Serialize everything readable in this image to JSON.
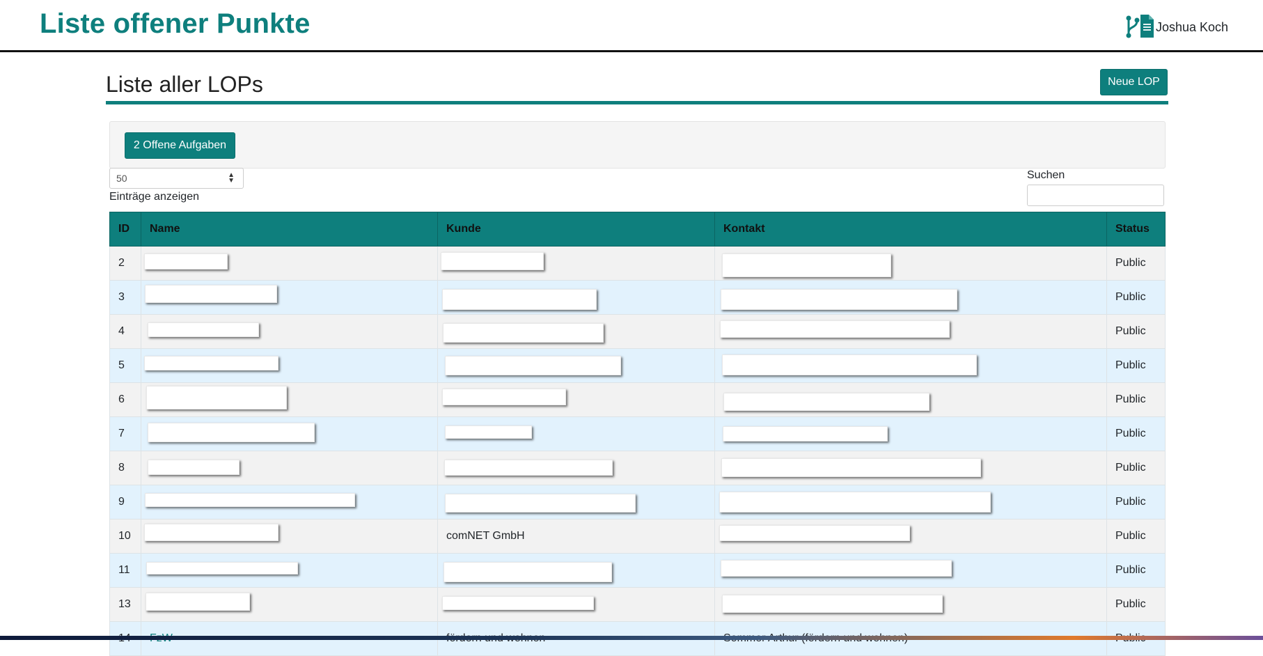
{
  "header": {
    "app_title": "Liste offener Punkte",
    "user_name": "Joshua Koch",
    "user_icon": "git-branch-document-icon"
  },
  "section": {
    "title": "Liste aller LOPs",
    "new_button": "Neue LOP"
  },
  "panel": {
    "open_tasks_button": "2 Offene Aufgaben"
  },
  "table_controls": {
    "page_length_value": "50",
    "page_length_label": "Einträge anzeigen",
    "search_label": "Suchen",
    "search_value": ""
  },
  "table": {
    "columns": [
      "ID",
      "Name",
      "Kunde",
      "Kontakt",
      "Status"
    ],
    "rows": [
      {
        "id": "2",
        "name": "",
        "kunde": "",
        "kontakt": "",
        "status": "Public"
      },
      {
        "id": "3",
        "name": "",
        "kunde": "",
        "kontakt": "",
        "status": "Public"
      },
      {
        "id": "4",
        "name": "",
        "kunde": "",
        "kontakt": "",
        "status": "Public"
      },
      {
        "id": "5",
        "name": "",
        "kunde": "",
        "kontakt": "",
        "status": "Public"
      },
      {
        "id": "6",
        "name": "",
        "kunde": "",
        "kontakt": "",
        "status": "Public"
      },
      {
        "id": "7",
        "name": "",
        "kunde": "",
        "kontakt": "",
        "status": "Public"
      },
      {
        "id": "8",
        "name": "",
        "kunde": "",
        "kontakt": "",
        "status": "Public"
      },
      {
        "id": "9",
        "name": "",
        "kunde": "",
        "kontakt": "",
        "status": "Public"
      },
      {
        "id": "10",
        "name": "",
        "kunde": "comNET GmbH",
        "kontakt": "",
        "status": "Public"
      },
      {
        "id": "11",
        "name": "",
        "kunde": "",
        "kontakt": "",
        "status": "Public"
      },
      {
        "id": "13",
        "name": "",
        "kunde": "",
        "kontakt": "",
        "status": "Public"
      },
      {
        "id": "14",
        "name": "FzW",
        "kunde": "fördern und wohnen",
        "kontakt": "Sommer Arthur (fördern und wohnen)",
        "status": "Public"
      }
    ]
  },
  "colors": {
    "accent": "#0e7f7d",
    "row_odd": "#f2f2f2",
    "row_even": "#e2f2fd"
  }
}
